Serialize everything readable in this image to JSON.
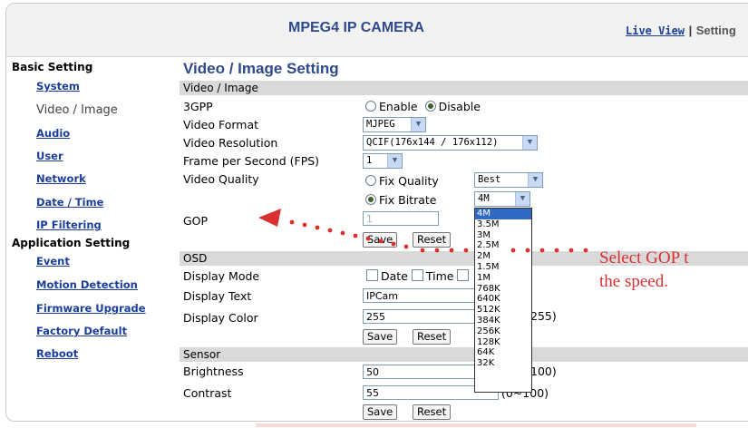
{
  "header": {
    "title": "MPEG4 IP CAMERA",
    "live_view": "Live View",
    "separator": "|",
    "setting": "Setting"
  },
  "sidebar": {
    "basic_title": "Basic Setting",
    "basic_items": [
      "System",
      "Video / Image",
      "Audio",
      "User",
      "Network",
      "Date / Time",
      "IP Filtering"
    ],
    "app_title": "Application Setting",
    "app_items": [
      "Event",
      "Motion Detection",
      "Firmware Upgrade",
      "Factory Default",
      "Reboot"
    ]
  },
  "page": {
    "title": "Video / Image Setting",
    "section_video": "Video / Image",
    "section_osd": "OSD",
    "section_sensor": "Sensor"
  },
  "video": {
    "gpp_label": "3GPP",
    "gpp_enable": "Enable",
    "gpp_disable": "Disable",
    "format_label": "Video Format",
    "format_value": "MJPEG",
    "resolution_label": "Video Resolution",
    "resolution_value": "QCIF(176x144 / 176x112)",
    "fps_label": "Frame per Second (FPS)",
    "fps_value": "1",
    "quality_label": "Video Quality",
    "fix_quality": "Fix Quality",
    "quality_value": "Best",
    "fix_bitrate": "Fix Bitrate",
    "bitrate_value": "4M",
    "gop_label": "GOP",
    "gop_value": "1",
    "bitrate_options": [
      "4M",
      "3.5M",
      "3M",
      "2.5M",
      "2M",
      "1.5M",
      "1M",
      "768K",
      "640K",
      "512K",
      "384K",
      "256K",
      "128K",
      "64K",
      "32K"
    ]
  },
  "osd": {
    "mode_label": "Display Mode",
    "date": "Date",
    "time": "Time",
    "text_label": "Display Text",
    "text_value": "IPCam",
    "color_label": "Display Color",
    "color_value": "255",
    "color_range": "255)"
  },
  "sensor": {
    "brightness_label": "Brightness",
    "brightness_value": "50",
    "brightness_range": "100)",
    "contrast_label": "Contrast",
    "contrast_value": "55",
    "contrast_range": "(0~100)"
  },
  "buttons": {
    "save": "Save",
    "reset": "Reset"
  },
  "annotation": {
    "line1": "Select GOP t",
    "line2": "the speed."
  },
  "colors": {
    "accent": "#2f4a8c",
    "link": "#1a3f9a",
    "annotation": "#d93030",
    "bar": "#d9d9d9",
    "highlight": "#316ac5"
  }
}
